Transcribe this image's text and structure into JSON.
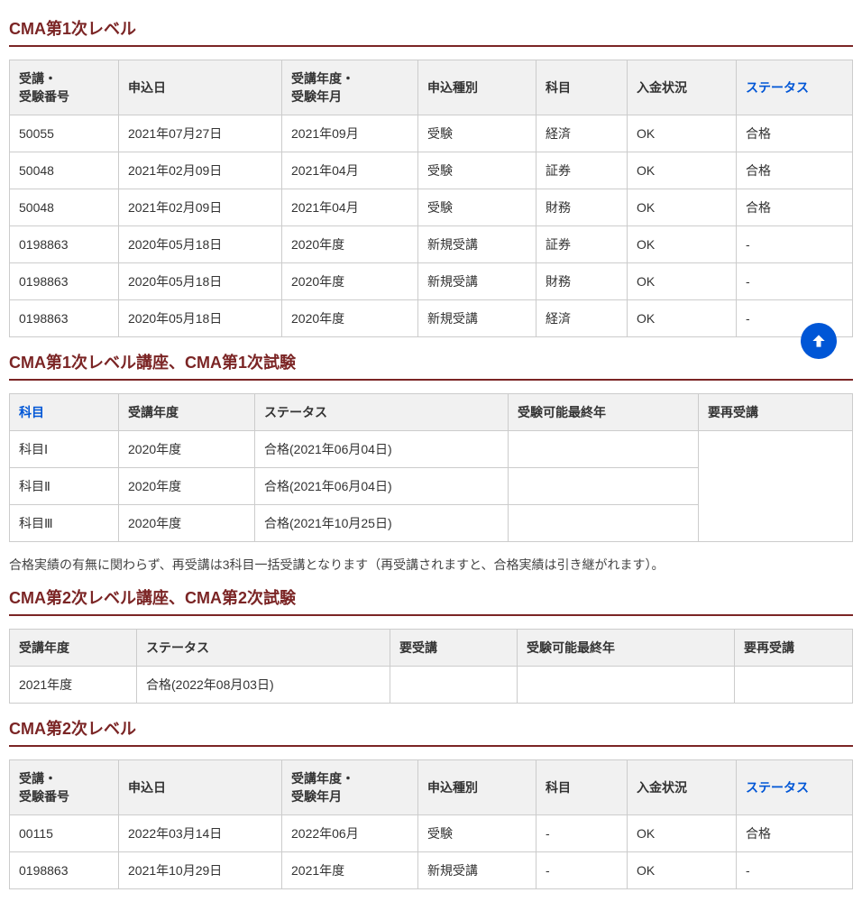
{
  "section1": {
    "title": "CMA第1次レベル",
    "headers": [
      "受講・\n受験番号",
      "申込日",
      "受講年度・\n受験年月",
      "申込種別",
      "科目",
      "入金状況",
      "ステータス"
    ],
    "status_header": "ステータス",
    "rows": [
      {
        "num": "50055",
        "date": "2021年07月27日",
        "term": "2021年09月",
        "kind": "受験",
        "subj": "経済",
        "pay": "OK",
        "status": "合格"
      },
      {
        "num": "50048",
        "date": "2021年02月09日",
        "term": "2021年04月",
        "kind": "受験",
        "subj": "証券",
        "pay": "OK",
        "status": "合格"
      },
      {
        "num": "50048",
        "date": "2021年02月09日",
        "term": "2021年04月",
        "kind": "受験",
        "subj": "財務",
        "pay": "OK",
        "status": "合格"
      },
      {
        "num": "0198863",
        "date": "2020年05月18日",
        "term": "2020年度",
        "kind": "新規受講",
        "subj": "証券",
        "pay": "OK",
        "status": "-"
      },
      {
        "num": "0198863",
        "date": "2020年05月18日",
        "term": "2020年度",
        "kind": "新規受講",
        "subj": "財務",
        "pay": "OK",
        "status": "-"
      },
      {
        "num": "0198863",
        "date": "2020年05月18日",
        "term": "2020年度",
        "kind": "新規受講",
        "subj": "経済",
        "pay": "OK",
        "status": "-"
      }
    ]
  },
  "section2": {
    "title": "CMA第1次レベル講座、CMA第1次試験",
    "headers": [
      "科目",
      "受講年度",
      "ステータス",
      "受験可能最終年",
      "要再受講"
    ],
    "subject_header": "科目",
    "rows": [
      {
        "subj": "科目Ⅰ",
        "year": "2020年度",
        "status": "合格(2021年06月04日)",
        "last": "",
        "re": ""
      },
      {
        "subj": "科目Ⅱ",
        "year": "2020年度",
        "status": "合格(2021年06月04日)",
        "last": "",
        "re": ""
      },
      {
        "subj": "科目Ⅲ",
        "year": "2020年度",
        "status": "合格(2021年10月25日)",
        "last": "",
        "re": ""
      }
    ],
    "note": "合格実績の有無に関わらず、再受講は3科目一括受講となります（再受講されますと、合格実績は引き継がれます）。"
  },
  "section3": {
    "title": "CMA第2次レベル講座、CMA第2次試験",
    "headers": [
      "受講年度",
      "ステータス",
      "要受講",
      "受験可能最終年",
      "要再受講"
    ],
    "rows": [
      {
        "year": "2021年度",
        "status": "合格(2022年08月03日)",
        "need": "",
        "last": "",
        "re": ""
      }
    ]
  },
  "section4": {
    "title": "CMA第2次レベル",
    "headers": [
      "受講・\n受験番号",
      "申込日",
      "受講年度・\n受験年月",
      "申込種別",
      "科目",
      "入金状況",
      "ステータス"
    ],
    "status_header": "ステータス",
    "rows": [
      {
        "num": "00115",
        "date": "2022年03月14日",
        "term": "2022年06月",
        "kind": "受験",
        "subj": "-",
        "pay": "OK",
        "status": "合格"
      },
      {
        "num": "0198863",
        "date": "2021年10月29日",
        "term": "2021年度",
        "kind": "新規受講",
        "subj": "-",
        "pay": "OK",
        "status": "-"
      }
    ]
  }
}
